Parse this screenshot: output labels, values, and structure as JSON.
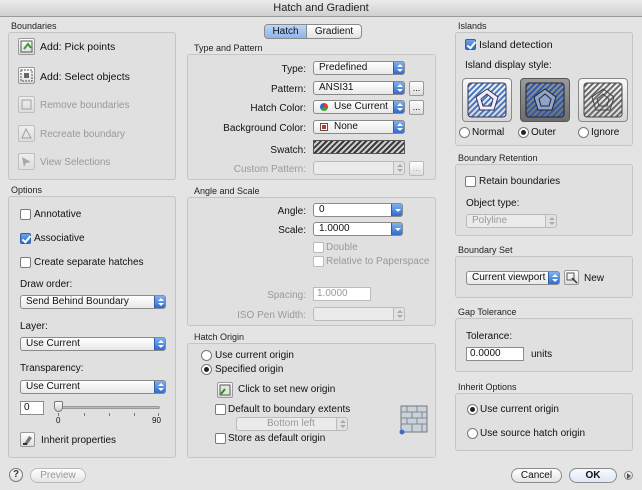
{
  "window": {
    "title": "Hatch and Gradient"
  },
  "tabs": [
    {
      "label": "Hatch",
      "selected": true
    },
    {
      "label": "Gradient",
      "selected": false
    }
  ],
  "boundaries": {
    "title": "Boundaries",
    "items": [
      {
        "label": "Add: Pick points",
        "enabled": true
      },
      {
        "label": "Add: Select objects",
        "enabled": true
      },
      {
        "label": "Remove boundaries",
        "enabled": false
      },
      {
        "label": "Recreate boundary",
        "enabled": false
      },
      {
        "label": "View Selections",
        "enabled": false
      }
    ]
  },
  "options": {
    "title": "Options",
    "annotative": {
      "label": "Annotative",
      "checked": false
    },
    "associative": {
      "label": "Associative",
      "checked": true
    },
    "separate": {
      "label": "Create separate hatches",
      "checked": false
    },
    "draw_order": {
      "label": "Draw order:",
      "value": "Send Behind Boundary"
    },
    "layer": {
      "label": "Layer:",
      "value": "Use Current"
    },
    "transparency": {
      "label": "Transparency:",
      "value": "Use Current",
      "amount": "0",
      "min": "0",
      "max": "90",
      "level": 0
    },
    "inherit": {
      "label": "Inherit properties"
    }
  },
  "type_pattern": {
    "title": "Type and Pattern",
    "type": {
      "label": "Type:",
      "value": "Predefined"
    },
    "pattern": {
      "label": "Pattern:",
      "value": "ANSI31",
      "more": "..."
    },
    "hatch_color": {
      "label": "Hatch Color:",
      "value": "Use Current",
      "more": "..."
    },
    "bg_color": {
      "label": "Background Color:",
      "value": "None"
    },
    "swatch": {
      "label": "Swatch:"
    },
    "custom": {
      "label": "Custom Pattern:",
      "value": "",
      "more": "..."
    }
  },
  "angle_scale": {
    "title": "Angle and Scale",
    "angle": {
      "label": "Angle:",
      "value": "0"
    },
    "scale": {
      "label": "Scale:",
      "value": "1.0000"
    },
    "double": {
      "label": "Double",
      "checked": false
    },
    "relative": {
      "label": "Relative to Paperspace",
      "checked": false
    },
    "spacing": {
      "label": "Spacing:",
      "value": "1.0000"
    },
    "iso": {
      "label": "ISO Pen Width:",
      "value": ""
    }
  },
  "origin": {
    "title": "Hatch Origin",
    "use_current": {
      "label": "Use current origin",
      "selected": false
    },
    "specified": {
      "label": "Specified origin",
      "selected": true
    },
    "click": {
      "label": "Click to set new origin"
    },
    "default_extents": {
      "label": "Default to boundary extents",
      "checked": false
    },
    "position": {
      "value": "Bottom left"
    },
    "store": {
      "label": "Store as default origin",
      "checked": false
    }
  },
  "islands": {
    "title": "Islands",
    "detection": {
      "label": "Island detection",
      "checked": true
    },
    "style_label": "Island display style:",
    "styles": [
      {
        "label": "Normal",
        "selected": false
      },
      {
        "label": "Outer",
        "selected": true
      },
      {
        "label": "Ignore",
        "selected": false
      }
    ]
  },
  "retention": {
    "title": "Boundary Retention",
    "retain": {
      "label": "Retain boundaries",
      "checked": false
    },
    "object_type": {
      "label": "Object type:",
      "value": "Polyline"
    }
  },
  "boundary_set": {
    "title": "Boundary Set",
    "value": "Current viewport",
    "new_label": "New"
  },
  "gap": {
    "title": "Gap Tolerance",
    "label": "Tolerance:",
    "value": "0.0000",
    "units": "units"
  },
  "inherit_options": {
    "title": "Inherit Options",
    "use_current": {
      "label": "Use current origin",
      "selected": true
    },
    "use_source": {
      "label": "Use source hatch origin",
      "selected": false
    }
  },
  "footer": {
    "help": "?",
    "preview": "Preview",
    "cancel": "Cancel",
    "ok": "OK"
  },
  "colors": {
    "accent": "#2e6ccf",
    "panel": "#e0e0e0",
    "window": "#e4e4e4"
  }
}
